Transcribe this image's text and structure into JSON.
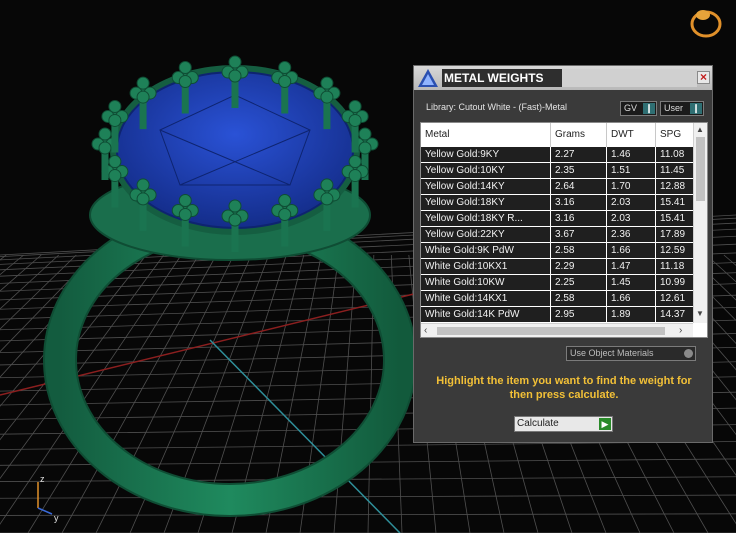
{
  "panel": {
    "title": "METAL WEIGHTS",
    "close": "×",
    "library_label": "Library: Cutout White - (Fast)-Metal",
    "dropdown_gv": "GV",
    "dropdown_user": "User",
    "use_object_materials": "Use Object Materials",
    "instructions": "Highlight the item you want to find the weight for then press calculate.",
    "calculate_label": "Calculate"
  },
  "table": {
    "columns": [
      "Metal",
      "Grams",
      "DWT",
      "SPG"
    ],
    "rows": [
      [
        "Yellow Gold:9KY",
        "2.27",
        "1.46",
        "11.08"
      ],
      [
        "Yellow Gold:10KY",
        "2.35",
        "1.51",
        "11.45"
      ],
      [
        "Yellow Gold:14KY",
        "2.64",
        "1.70",
        "12.88"
      ],
      [
        "Yellow Gold:18KY",
        "3.16",
        "2.03",
        "15.41"
      ],
      [
        "Yellow Gold:18KY R...",
        "3.16",
        "2.03",
        "15.41"
      ],
      [
        "Yellow Gold:22KY",
        "3.67",
        "2.36",
        "17.89"
      ],
      [
        "White Gold:9K PdW",
        "2.58",
        "1.66",
        "12.59"
      ],
      [
        "White Gold:10KX1",
        "2.29",
        "1.47",
        "11.18"
      ],
      [
        "White Gold:10KW",
        "2.25",
        "1.45",
        "10.99"
      ],
      [
        "White Gold:14KX1",
        "2.58",
        "1.66",
        "12.61"
      ],
      [
        "White Gold:14K PdW",
        "2.95",
        "1.89",
        "14.37"
      ]
    ]
  },
  "viewport": {
    "axis_labels": {
      "z": "z",
      "y": "y"
    },
    "colors": {
      "ring": "#1d7a55",
      "gem": "#1f3fb0",
      "grid": "#8a8a8a",
      "x_axis": "#8b1f1f",
      "y_axis": "#2f8f9a",
      "panel_accent": "#f2c037"
    }
  }
}
